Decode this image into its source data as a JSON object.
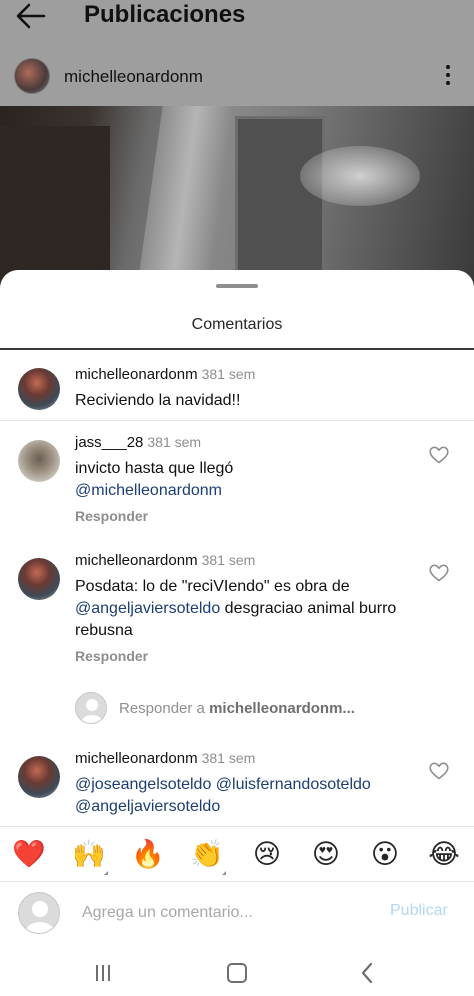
{
  "topbar": {
    "title": "Publicaciones"
  },
  "post": {
    "username": "michelleonardonm"
  },
  "sheet": {
    "title": "Comentarios"
  },
  "comments": [
    {
      "username": "michelleonardonm",
      "time": "381 sem",
      "text": "Reciviendo la navidad!!"
    },
    {
      "username": "jass___28",
      "time": "381 sem",
      "text_plain": "invicto hasta que llegó",
      "mention": "@michelleonardonm",
      "reply": "Responder"
    },
    {
      "username": "michelleonardonm",
      "time": "381 sem",
      "text_before": "Posdata: lo de \"reciVIendo\" es obra de",
      "mention": "@angeljaviersoteldo",
      "text_after": " desgraciao animal burro rebusna",
      "reply": "Responder"
    },
    {
      "username": "michelleonardonm",
      "time": "381 sem",
      "mention1": "@joseangelsoteldo",
      "mention2": "@luisfernandosoteldo",
      "mention3": "@angeljaviersoteldo"
    }
  ],
  "reply_prompt": {
    "prefix": "Responder a ",
    "username": "michelleonardonm..."
  },
  "emoji_bar": [
    "❤️",
    "🙌",
    "🔥",
    "👏",
    "😢",
    "😍",
    "😮",
    "😂"
  ],
  "input": {
    "placeholder": "Agrega un comentario...",
    "publish_label": "Publicar"
  },
  "colors": {
    "mention": "#1c3e74",
    "publish_disabled": "#b3d7f5",
    "secondary_text": "#8e8e8e"
  }
}
